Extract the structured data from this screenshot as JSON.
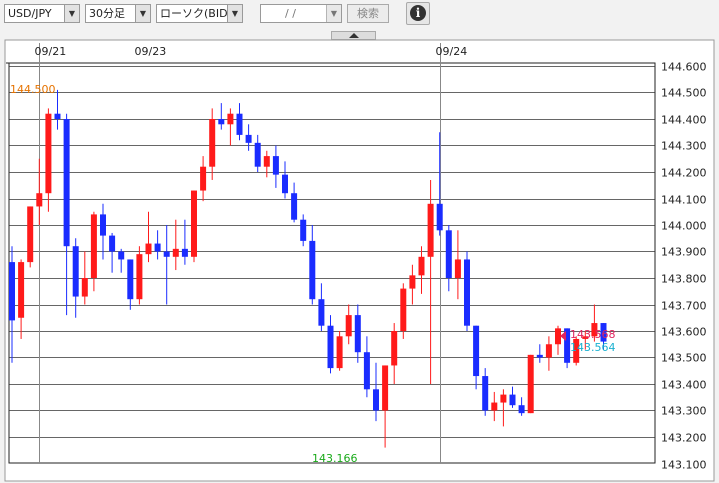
{
  "toolbar": {
    "pair": "USD/JPY",
    "interval": "30分足",
    "chart_type": "ローソク(BID)",
    "date_placeholder": "  /  /",
    "search_label": "検索",
    "info_icon": "info-icon"
  },
  "colors": {
    "up": "#ff1a1a",
    "down": "#1a2cff",
    "max_label": "#e67300",
    "min_label": "#1aaa1a",
    "ask_marker": "#e0245e",
    "bid_marker": "#1ab0d0"
  },
  "chart_data": {
    "type": "candlestick",
    "title": "",
    "ylim": [
      143.1,
      144.65
    ],
    "y_ticks": [
      "144.600",
      "144.500",
      "144.400",
      "144.300",
      "144.200",
      "144.100",
      "144.000",
      "143.900",
      "143.800",
      "143.700",
      "143.600",
      "143.500",
      "143.400",
      "143.300",
      "143.200",
      "143.100"
    ],
    "date_labels": [
      {
        "label": "09/21",
        "index": 3
      },
      {
        "label": "09/23",
        "index": 14
      },
      {
        "label": "09/24",
        "index": 47
      }
    ],
    "max_label": "144.500",
    "min_label": "143.166",
    "current_ask": "143.568",
    "current_bid": "143.564",
    "candles": [
      [
        143.86,
        143.92,
        143.48,
        143.64
      ],
      [
        143.65,
        143.87,
        143.57,
        143.86
      ],
      [
        143.86,
        144.07,
        143.84,
        144.07
      ],
      [
        144.07,
        144.25,
        144.0,
        144.12
      ],
      [
        144.12,
        144.44,
        144.05,
        144.42
      ],
      [
        144.42,
        144.51,
        144.36,
        144.4
      ],
      [
        144.4,
        144.42,
        143.66,
        143.92
      ],
      [
        143.92,
        143.95,
        143.65,
        143.73
      ],
      [
        143.73,
        143.9,
        143.7,
        143.8
      ],
      [
        143.8,
        144.05,
        143.75,
        144.04
      ],
      [
        144.04,
        144.08,
        143.87,
        143.96
      ],
      [
        143.96,
        143.97,
        143.82,
        143.9
      ],
      [
        143.9,
        143.91,
        143.82,
        143.87
      ],
      [
        143.87,
        143.87,
        143.68,
        143.72
      ],
      [
        143.72,
        143.92,
        143.7,
        143.89
      ],
      [
        143.89,
        144.05,
        143.86,
        143.93
      ],
      [
        143.93,
        143.98,
        143.87,
        143.9
      ],
      [
        143.9,
        144.0,
        143.7,
        143.88
      ],
      [
        143.88,
        144.02,
        143.83,
        143.91
      ],
      [
        143.91,
        144.02,
        143.85,
        143.88
      ],
      [
        143.88,
        144.13,
        143.86,
        144.13
      ],
      [
        144.13,
        144.26,
        144.09,
        144.22
      ],
      [
        144.22,
        144.44,
        144.17,
        144.4
      ],
      [
        144.4,
        144.46,
        144.36,
        144.38
      ],
      [
        144.38,
        144.44,
        144.3,
        144.42
      ],
      [
        144.42,
        144.46,
        144.32,
        144.34
      ],
      [
        144.34,
        144.38,
        144.28,
        144.31
      ],
      [
        144.31,
        144.34,
        144.2,
        144.22
      ],
      [
        144.22,
        144.28,
        144.18,
        144.26
      ],
      [
        144.26,
        144.3,
        144.14,
        144.19
      ],
      [
        144.19,
        144.24,
        144.1,
        144.12
      ],
      [
        144.12,
        144.16,
        144.01,
        144.02
      ],
      [
        144.02,
        144.04,
        143.92,
        143.94
      ],
      [
        143.94,
        144.0,
        143.7,
        143.72
      ],
      [
        143.72,
        143.78,
        143.6,
        143.62
      ],
      [
        143.62,
        143.66,
        143.44,
        143.46
      ],
      [
        143.46,
        143.6,
        143.45,
        143.58
      ],
      [
        143.58,
        143.7,
        143.55,
        143.66
      ],
      [
        143.66,
        143.7,
        143.48,
        143.52
      ],
      [
        143.52,
        143.58,
        143.35,
        143.38
      ],
      [
        143.38,
        143.48,
        143.26,
        143.3
      ],
      [
        143.3,
        143.47,
        143.16,
        143.47
      ],
      [
        143.47,
        143.63,
        143.4,
        143.6
      ],
      [
        143.6,
        143.78,
        143.57,
        143.76
      ],
      [
        143.76,
        143.85,
        143.7,
        143.81
      ],
      [
        143.81,
        143.92,
        143.74,
        143.88
      ],
      [
        143.88,
        144.17,
        143.4,
        144.08
      ],
      [
        144.08,
        144.35,
        143.96,
        143.98
      ],
      [
        143.98,
        144.0,
        143.75,
        143.8
      ],
      [
        143.8,
        143.98,
        143.72,
        143.87
      ],
      [
        143.87,
        143.9,
        143.6,
        143.62
      ],
      [
        143.62,
        143.62,
        143.38,
        143.43
      ],
      [
        143.43,
        143.46,
        143.28,
        143.3
      ],
      [
        143.3,
        143.37,
        143.26,
        143.33
      ],
      [
        143.33,
        143.38,
        143.24,
        143.36
      ],
      [
        143.36,
        143.39,
        143.31,
        143.32
      ],
      [
        143.32,
        143.35,
        143.28,
        143.29
      ],
      [
        143.29,
        143.51,
        143.29,
        143.51
      ],
      [
        143.51,
        143.55,
        143.48,
        143.5
      ],
      [
        143.5,
        143.58,
        143.45,
        143.55
      ],
      [
        143.55,
        143.62,
        143.51,
        143.61
      ],
      [
        143.61,
        143.61,
        143.46,
        143.48
      ],
      [
        143.48,
        143.58,
        143.47,
        143.57
      ],
      [
        143.57,
        143.6,
        143.53,
        143.58
      ],
      [
        143.58,
        143.7,
        143.56,
        143.63
      ],
      [
        143.63,
        143.63,
        143.53,
        143.56
      ]
    ]
  }
}
